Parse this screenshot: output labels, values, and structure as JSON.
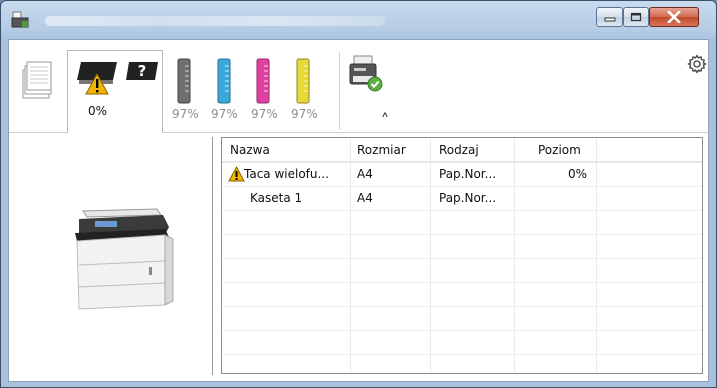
{
  "window": {
    "title": ""
  },
  "toolbar": {
    "toner_warning_label": "0%",
    "toners": [
      {
        "color": "#6f6f6f",
        "label": "97%"
      },
      {
        "color": "#39a9dc",
        "label": "97%"
      },
      {
        "color": "#e040a0",
        "label": "97%"
      },
      {
        "color": "#e6d93a",
        "label": "97%"
      }
    ],
    "unknown_glyph": "?",
    "collapse_glyph": "∧"
  },
  "table": {
    "headers": [
      "Nazwa",
      "Rozmiar",
      "Rodzaj",
      "Poziom"
    ],
    "rows": [
      {
        "name": "Taca wielofu...",
        "size": "A4",
        "type": "Pap.Nor...",
        "level": "0%",
        "warning": true
      },
      {
        "name": "Kaseta 1",
        "size": "A4",
        "type": "Pap.Nor...",
        "level": "",
        "warning": false
      }
    ]
  },
  "colors": {
    "accent_warning": "#f0b400",
    "close_red": "#c04a2c"
  }
}
